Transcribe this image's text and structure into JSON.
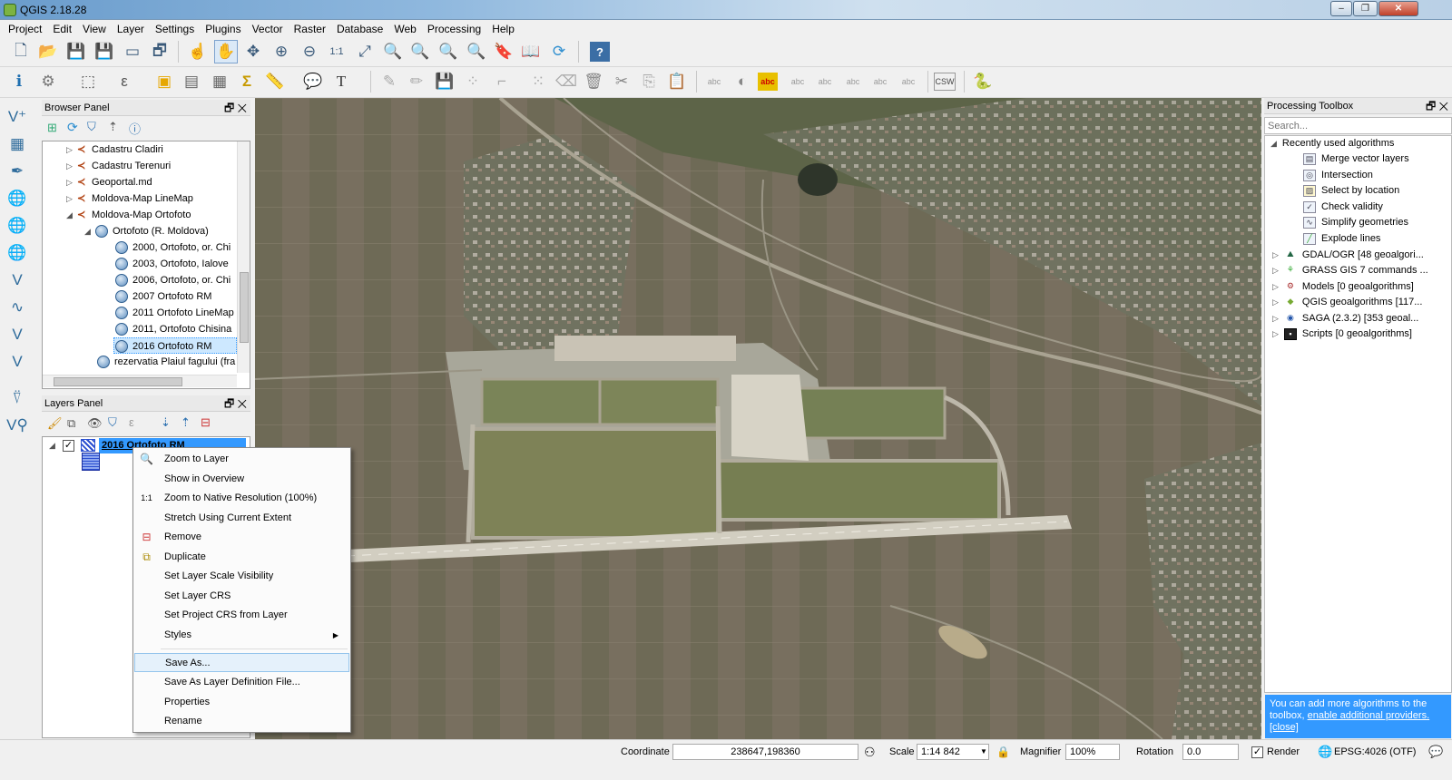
{
  "window": {
    "title": "QGIS 2.18.28",
    "min_label": "–",
    "max_label": "❐",
    "close_label": "✕"
  },
  "menu": [
    "Project",
    "Edit",
    "View",
    "Layer",
    "Settings",
    "Plugins",
    "Vector",
    "Raster",
    "Database",
    "Web",
    "Processing",
    "Help"
  ],
  "browser_panel": {
    "title": "Browser Panel",
    "items": [
      {
        "label": "Cadastru Cladiri",
        "arrow": "▷",
        "icon": "wms-icon"
      },
      {
        "label": "Cadastru Terenuri",
        "arrow": "▷",
        "icon": "wms-icon"
      },
      {
        "label": "Geoportal.md",
        "arrow": "▷",
        "icon": "wms-icon"
      },
      {
        "label": "Moldova-Map LineMap",
        "arrow": "▷",
        "icon": "wms-icon"
      },
      {
        "label": "Moldova-Map Ortofoto",
        "arrow": "◢",
        "icon": "wms-icon"
      },
      {
        "label": "Ortofoto (R. Moldova)",
        "arrow": "◢",
        "icon": "globe-icon"
      },
      {
        "label": "2000, Ortofoto, or. Chi",
        "icon": "globe-icon"
      },
      {
        "label": "2003, Ortofoto, Ialove",
        "icon": "globe-icon"
      },
      {
        "label": "2006, Ortofoto, or. Chi",
        "icon": "globe-icon"
      },
      {
        "label": "2007 Ortofoto RM",
        "icon": "globe-icon"
      },
      {
        "label": "2011 Ortofoto LineMap",
        "icon": "globe-icon"
      },
      {
        "label": "2011, Ortofoto Chisina",
        "icon": "globe-icon"
      },
      {
        "label": "2016 Ortofoto RM",
        "icon": "globe-icon",
        "selected": true
      },
      {
        "label": "rezervatia Plaiul fagului (fra",
        "icon": "globe-icon"
      }
    ]
  },
  "layers_panel": {
    "title": "Layers Panel",
    "layer": "2016 Ortofoto RM",
    "checked_label": "✓"
  },
  "context_menu": {
    "items": [
      {
        "label": "Zoom to Layer",
        "icon": "magnifier-icon"
      },
      {
        "label": "Show in Overview"
      },
      {
        "label": "Zoom to Native Resolution (100%)",
        "icon": "zoom-native-icon"
      },
      {
        "label": "Stretch Using Current Extent"
      },
      {
        "label": "Remove",
        "icon": "remove-layer-icon"
      },
      {
        "label": "Duplicate",
        "icon": "duplicate-icon"
      },
      {
        "label": "Set Layer Scale Visibility"
      },
      {
        "label": "Set Layer CRS"
      },
      {
        "label": "Set Project CRS from Layer"
      },
      {
        "label": "Styles",
        "submenu": true
      },
      {
        "label": "Save As...",
        "highlighted": true
      },
      {
        "label": "Save As Layer Definition File..."
      },
      {
        "label": "Properties"
      },
      {
        "label": "Rename"
      }
    ],
    "submenu_arrow": "▶"
  },
  "processing": {
    "title": "Processing Toolbox",
    "search_placeholder": "Search...",
    "recent_label": "Recently used algorithms",
    "recent": [
      "Merge vector layers",
      "Intersection",
      "Select by location",
      "Check validity",
      "Simplify geometries",
      "Explode lines"
    ],
    "providers": [
      "GDAL/OGR [48 geoalgori...",
      "GRASS GIS 7 commands ...",
      "Models [0 geoalgorithms]",
      "QGIS geoalgorithms [117...",
      "SAGA (2.3.2) [353 geoal...",
      "Scripts [0 geoalgorithms]"
    ],
    "notice_text": "You can add more algorithms to the toolbox,",
    "notice_link": "enable additional providers.",
    "notice_close": "[close]"
  },
  "status": {
    "coordinate_label": "Coordinate",
    "coordinate": "238647,198360",
    "scale_label": "Scale",
    "scale": "1:14 842",
    "magnifier_label": "Magnifier",
    "magnifier": "100%",
    "rotation_label": "Rotation",
    "rotation": "0.0",
    "render_label": "Render",
    "crs": "EPSG:4026 (OTF)"
  },
  "toolbar": {
    "csw_label": "CSW",
    "help_label": "?",
    "text_label": "T",
    "abc_label": "abc",
    "sigma_label": "Σ"
  },
  "colors": {
    "accent": "#3399ff",
    "selection": "#cde8ff",
    "notice_bg": "#3399ff"
  }
}
